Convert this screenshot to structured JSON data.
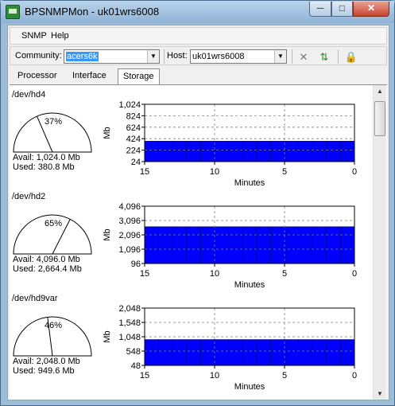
{
  "window": {
    "title": "BPSNMPMon - uk01wrs6008",
    "min": "─",
    "max": "□",
    "close": "✕"
  },
  "menu": {
    "snmp": "SNMP",
    "help": "Help"
  },
  "toolbar": {
    "community_label": "Community:",
    "community_value": "acers6k",
    "host_label": "Host:",
    "host_value": "uk01wrs6008"
  },
  "icons": {
    "disconnect": "disconnect-icon",
    "connect": "connect-icon",
    "lock": "lock-icon"
  },
  "tabs": [
    "Processor",
    "Interface",
    "Storage"
  ],
  "active_tab": "Storage",
  "colors": {
    "bar": "#0000ff",
    "bar_edge": "#000080",
    "plot_bg": "#ffffff",
    "grid": "#808080"
  },
  "devices": [
    {
      "name": "/dev/hd4",
      "percent": 37,
      "percent_label": "37%",
      "avail": "Avail: 1,024.0 Mb",
      "used": "Used: 380.8 Mb"
    },
    {
      "name": "/dev/hd2",
      "percent": 65,
      "percent_label": "65%",
      "avail": "Avail: 4,096.0 Mb",
      "used": "Used: 2,664.4 Mb"
    },
    {
      "name": "/dev/hd9var",
      "percent": 46,
      "percent_label": "46%",
      "avail": "Avail: 2,048.0 Mb",
      "used": "Used: 949.6 Mb"
    }
  ],
  "chart_data": [
    {
      "type": "bar",
      "ylabel": "Mb",
      "xlabel": "Minutes",
      "yticks": [
        "1,024",
        "824",
        "624",
        "424",
        "224",
        "24"
      ],
      "ylim": [
        24,
        1024
      ],
      "xticks": [
        "15",
        "10",
        "5",
        "0"
      ],
      "xlim": [
        15,
        0
      ],
      "categories": [
        15,
        14,
        13,
        12,
        11,
        10,
        9,
        8,
        7,
        6,
        5,
        4,
        3,
        2,
        1
      ],
      "values": [
        380.8,
        380.8,
        380.8,
        380.8,
        380.8,
        380.8,
        380.8,
        380.8,
        380.8,
        380.8,
        380.8,
        380.8,
        380.8,
        380.8,
        380.8
      ],
      "grid": true
    },
    {
      "type": "bar",
      "ylabel": "Mb",
      "xlabel": "Minutes",
      "yticks": [
        "4,096",
        "3,096",
        "2,096",
        "1,096",
        "96"
      ],
      "ylim": [
        96,
        4096
      ],
      "xticks": [
        "15",
        "10",
        "5",
        "0"
      ],
      "xlim": [
        15,
        0
      ],
      "categories": [
        15,
        14,
        13,
        12,
        11,
        10,
        9,
        8,
        7,
        6,
        5,
        4,
        3,
        2,
        1
      ],
      "values": [
        2664.4,
        2664.4,
        2664.4,
        2664.4,
        2664.4,
        2664.4,
        2664.4,
        2664.4,
        2664.4,
        2664.4,
        2664.4,
        2664.4,
        2664.4,
        2664.4,
        2664.4
      ],
      "grid": true
    },
    {
      "type": "bar",
      "ylabel": "Mb",
      "xlabel": "Minutes",
      "yticks": [
        "2,048",
        "1,548",
        "1,048",
        "548",
        "48"
      ],
      "ylim": [
        48,
        2048
      ],
      "xticks": [
        "15",
        "10",
        "5",
        "0"
      ],
      "xlim": [
        15,
        0
      ],
      "categories": [
        15,
        14,
        13,
        12,
        11,
        10,
        9,
        8,
        7,
        6,
        5,
        4,
        3,
        2,
        1
      ],
      "values": [
        949.6,
        949.6,
        949.6,
        949.6,
        949.6,
        949.6,
        949.6,
        949.6,
        949.6,
        949.6,
        949.6,
        949.6,
        949.6,
        949.6,
        949.6
      ],
      "grid": true
    }
  ]
}
